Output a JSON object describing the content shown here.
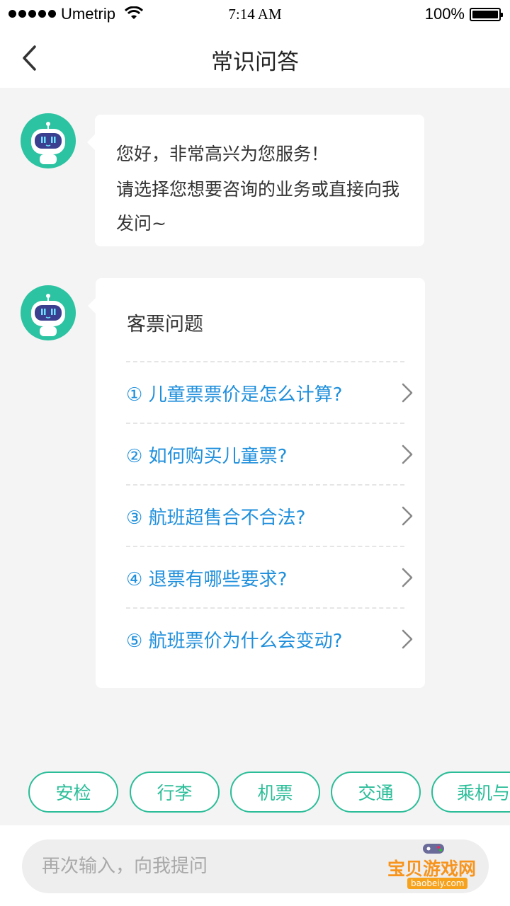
{
  "status_bar": {
    "carrier": "Umetrip",
    "time": "7:14 AM",
    "battery": "100%",
    "battery_level": 1.0
  },
  "nav": {
    "title": "常识问答",
    "back_icon": "chevron-left-icon"
  },
  "chat": {
    "greeting": {
      "line1": "您好，非常高兴为您服务！",
      "line2": "请选择您想要咨询的业务或直接向我发问~"
    },
    "faq_card": {
      "title": "客票问题",
      "items": [
        "① 儿童票票价是怎么计算?",
        "② 如何购买儿童票?",
        "③ 航班超售合不合法?",
        "④  退票有哪些要求?",
        "⑤  航班票价为什么会变动?"
      ]
    }
  },
  "quick_tags": [
    "安检",
    "行李",
    "机票",
    "交通",
    "乘机与"
  ],
  "input": {
    "placeholder": "再次输入，向我提问"
  },
  "watermark": {
    "text": "宝贝游戏网",
    "url": "baobeiy.com"
  },
  "colors": {
    "accent_green": "#2bbd98",
    "link_blue": "#1f8fdc",
    "avatar_green": "#2bc3a1"
  }
}
